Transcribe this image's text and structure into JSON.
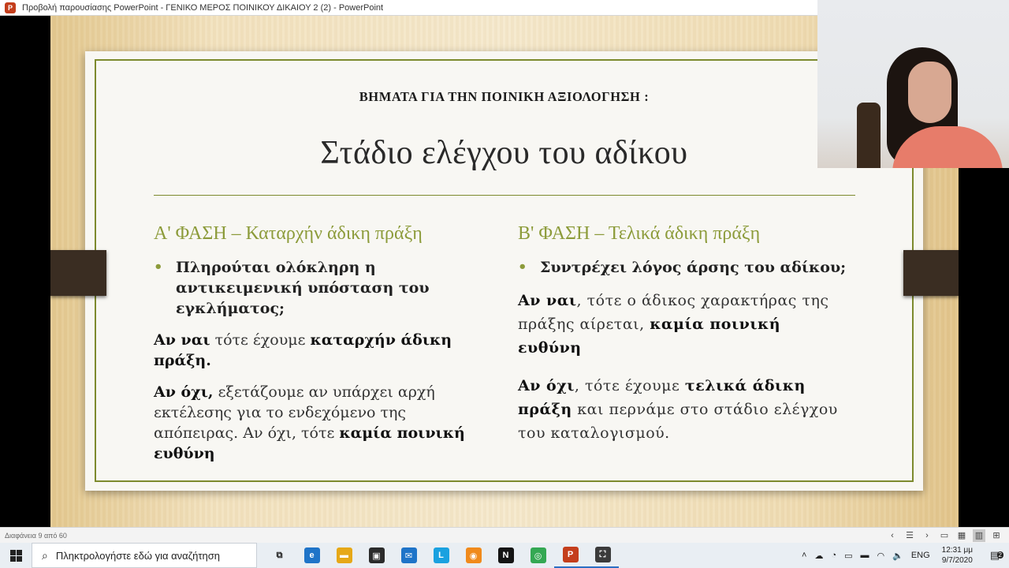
{
  "window": {
    "title": "Προβολή παρουσίασης PowerPoint  -  ΓΕΝΙΚΟ ΜΕΡΟΣ ΠΟΙΝΙΚΟΥ ΔΙΚΑΙΟΥ 2 (2) - PowerPoint",
    "app_icon": "P"
  },
  "slide": {
    "subtitle": "ΒΗΜΑΤΑ ΓΙΑ ΤΗΝ ΠΟΙΝΙΚΗ ΑΞΙΟΛΟΓΗΣΗ :",
    "title": "Στάδιο ελέγχου του αδίκου",
    "colA": {
      "heading": "Α' ΦΑΣΗ – Καταρχήν άδικη πράξη",
      "bullet": "Πληρούται ολόκληρη η αντικειμενική υπόσταση του εγκλήματος;",
      "p1_bold": "Αν ναι",
      "p1_mid": " τότε έχουμε ",
      "p1_bold2": "καταρχήν άδικη πράξη.",
      "p2_bold": "Αν όχι,",
      "p2_text": " εξετάζουμε αν υπάρχει αρχή εκτέλεσης για το ενδεχόμενο της απόπειρας. Αν όχι, τότε ",
      "p2_bold2": "καμία ποινική ευθύνη"
    },
    "colB": {
      "heading": "Β' ΦΑΣΗ – Τελικά άδικη πράξη",
      "bullet": "Συντρέχει λόγος άρσης του αδίκου;",
      "p1_bold": "Αν ναι",
      "p1_text": ", τότε ο άδικος χαρακτήρας της πράξης αίρεται, ",
      "p1_bold2": "καμία ποινική ευθύνη",
      "p2_bold": "Αν όχι",
      "p2_mid": ", τότε έχουμε ",
      "p2_bold2": "τελικά άδικη πράξη",
      "p2_text": " και περνάμε στο στάδιο ελέγχου του καταλογισμού."
    }
  },
  "statusbar": {
    "slide_counter": "Διαφάνεια 9 από 60"
  },
  "taskbar": {
    "search_placeholder": "Πληκτρολογήστε εδώ για αναζήτηση",
    "apps": [
      {
        "name": "task-view",
        "glyph": "⧉",
        "color": "transparent"
      },
      {
        "name": "edge",
        "glyph": "e",
        "color": "#1f74c8"
      },
      {
        "name": "file-explorer",
        "glyph": "▬",
        "color": "#e6a817"
      },
      {
        "name": "store",
        "glyph": "▣",
        "color": "#2b2b2b"
      },
      {
        "name": "mail",
        "glyph": "✉",
        "color": "#1f74c8"
      },
      {
        "name": "lexico",
        "glyph": "L",
        "color": "#1aa1e0"
      },
      {
        "name": "app-orange",
        "glyph": "◉",
        "color": "#f08a1c"
      },
      {
        "name": "netflix",
        "glyph": "N",
        "color": "#141414"
      },
      {
        "name": "chrome",
        "glyph": "◎",
        "color": "#34a853"
      },
      {
        "name": "powerpoint",
        "glyph": "P",
        "color": "#c43e1c"
      },
      {
        "name": "snipping",
        "glyph": "⛶",
        "color": "#3b3b3b"
      }
    ],
    "lang": "ENG",
    "time": "12:31 μμ",
    "date": "9/7/2020",
    "notifications": "2"
  },
  "colors": {
    "accent": "#8c9b3a",
    "frame": "#7d8a2e",
    "strap": "#3a2d22"
  }
}
